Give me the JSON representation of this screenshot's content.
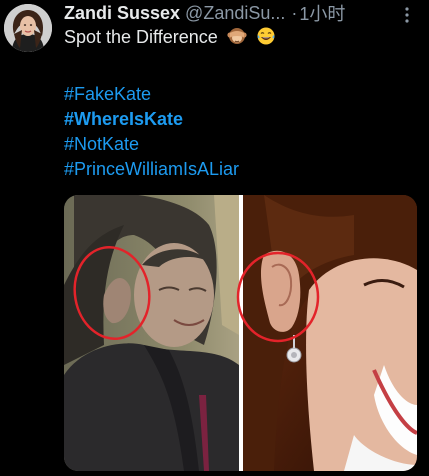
{
  "tweet": {
    "display_name": "Zandi Sussex",
    "handle": "@ZandiSu...",
    "separator": "·",
    "time": "1小时",
    "text": "Spot the Difference",
    "emojis": [
      "see-no-evil-monkey",
      "laughing-tears"
    ],
    "hashtags": [
      {
        "text": "#FakeKate"
      },
      {
        "text": "#WhereIsKate"
      },
      {
        "text": "#NotKate"
      },
      {
        "text": "#PrinceWilliamIsALiar"
      }
    ]
  },
  "colors": {
    "background": "#000000",
    "text": "#e7e9ea",
    "secondary": "#8b98a5",
    "link": "#1d9bf0",
    "circle_annotation": "#e3232a"
  },
  "icons": {
    "more": "more-vertical-icon",
    "avatar": "avatar"
  }
}
